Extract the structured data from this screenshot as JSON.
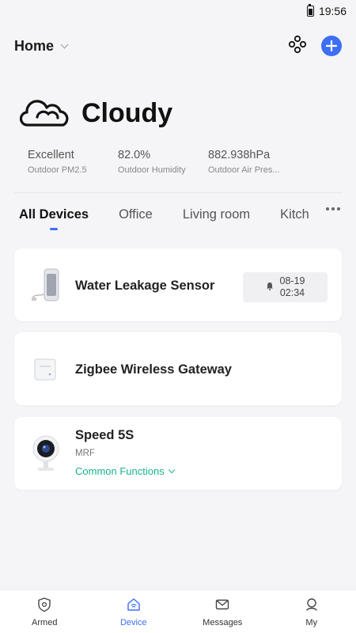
{
  "status_bar": {
    "time": "19:56"
  },
  "header": {
    "home_label": "Home"
  },
  "weather": {
    "condition": "Cloudy",
    "stats": [
      {
        "value": "Excellent",
        "label": "Outdoor PM2.5"
      },
      {
        "value": "82.0%",
        "label": "Outdoor Humidity"
      },
      {
        "value": "882.938hPa",
        "label": "Outdoor Air Pres..."
      }
    ]
  },
  "tabs": [
    {
      "label": "All Devices"
    },
    {
      "label": "Office"
    },
    {
      "label": "Living room"
    },
    {
      "label": "Kitch"
    }
  ],
  "devices": [
    {
      "name": "Water Leakage Sensor",
      "alarm_date": "08-19",
      "alarm_time": "02:34"
    },
    {
      "name": "Zigbee Wireless Gateway"
    },
    {
      "name": "Speed 5S",
      "subtitle": "MRF",
      "action_label": "Common Functions"
    }
  ],
  "bottom_nav": [
    {
      "label": "Armed",
      "icon": "shield-icon"
    },
    {
      "label": "Device",
      "icon": "home-device-icon"
    },
    {
      "label": "Messages",
      "icon": "envelope-icon"
    },
    {
      "label": "My",
      "icon": "profile-icon"
    }
  ],
  "colors": {
    "accent": "#3d6ef6",
    "green": "#1ab38a",
    "background": "#f5f5f7"
  }
}
